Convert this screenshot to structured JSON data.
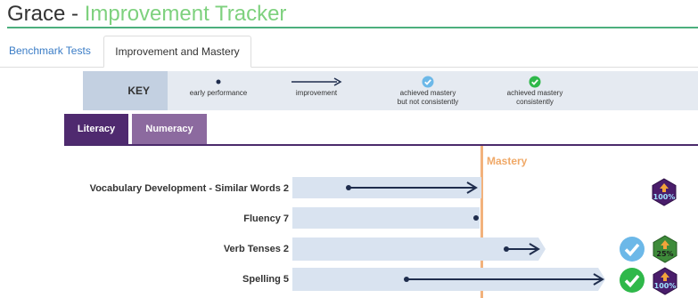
{
  "header": {
    "name": "Grace",
    "separator": " - ",
    "app_title": "Improvement Tracker"
  },
  "tabs": [
    {
      "label": "Benchmark Tests",
      "active": false
    },
    {
      "label": "Improvement and Mastery",
      "active": true
    }
  ],
  "key": {
    "label": "KEY",
    "items": [
      {
        "icon": "dot-icon",
        "text": "early performance"
      },
      {
        "icon": "arrow-icon",
        "text": "improvement"
      },
      {
        "icon": "check-badge-icon",
        "text_line1": "achieved mastery",
        "text_line2": "but not consistently"
      },
      {
        "icon": "check-circle-icon",
        "text_line1": "achieved mastery",
        "text_line2": "consistently"
      }
    ]
  },
  "subject_tabs": [
    {
      "label": "Literacy",
      "active": true
    },
    {
      "label": "Numeracy",
      "active": false
    }
  ],
  "mastery_label": "Mastery",
  "rows": [
    {
      "label": "Vocabulary Development - Similar Words 2",
      "badge_text": "100%"
    },
    {
      "label": "Fluency 7"
    },
    {
      "label": "Verb Tenses 2",
      "badge_text": "25%"
    },
    {
      "label": "Spelling 5",
      "badge_text": "100%"
    }
  ],
  "colors": {
    "accent_green": "#7ed17e",
    "literacy_tab": "#4f2a6f",
    "numeracy_tab": "#8c6a9f",
    "mastery_line": "#f2b27c",
    "bar_fill": "#d9e3f0",
    "arrow": "#1f2d4d",
    "check_light": "#6cb8e8",
    "check_green": "#2fb84a"
  }
}
